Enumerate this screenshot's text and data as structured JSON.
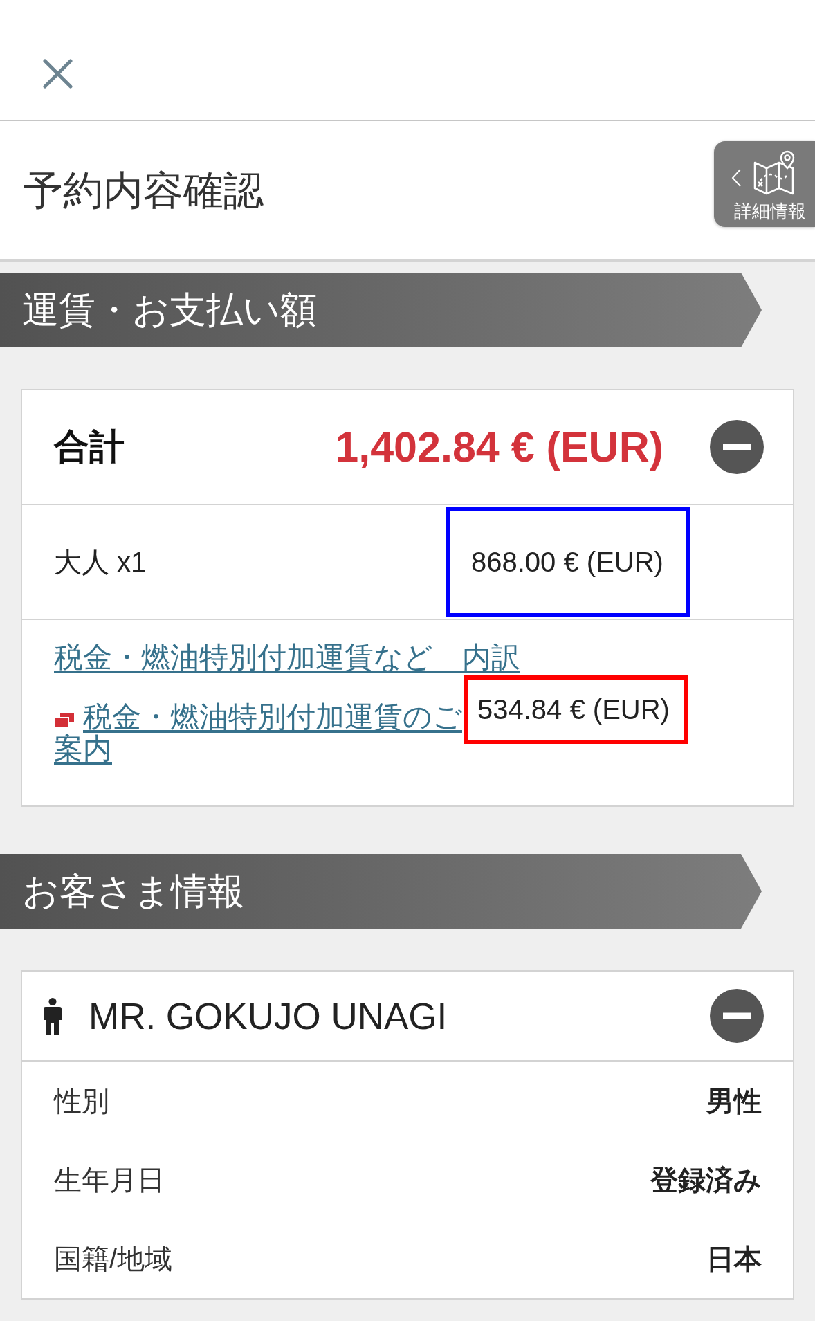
{
  "page_title": "予約内容確認",
  "detail_button": {
    "label": "詳細情報"
  },
  "fare": {
    "title": "運賃・お支払い額",
    "total_label": "合計",
    "total_amount": "1,402.84 € (EUR)",
    "expanded": true,
    "rows": [
      {
        "kind": "line",
        "label": "大人 x1",
        "amount": "868.00 € (EUR)",
        "color": "#0000ff"
      },
      {
        "kind": "links",
        "links": [
          {
            "text": "税金・燃油特別付加運賃など　内訳",
            "external": false
          },
          {
            "text": "税金・燃油特別付加運賃のご案内",
            "external": true
          }
        ],
        "amount": "534.84 € (EUR)",
        "color": "#ff0000"
      }
    ]
  },
  "passenger_section": {
    "title": "お客さま情報",
    "name": "MR. GOKUJO UNAGI",
    "expanded": true,
    "fields": [
      {
        "label": "性別",
        "value": "男性"
      },
      {
        "label": "生年月日",
        "value": "登録済み"
      },
      {
        "label": "国籍/地域",
        "value": "日本"
      }
    ]
  }
}
